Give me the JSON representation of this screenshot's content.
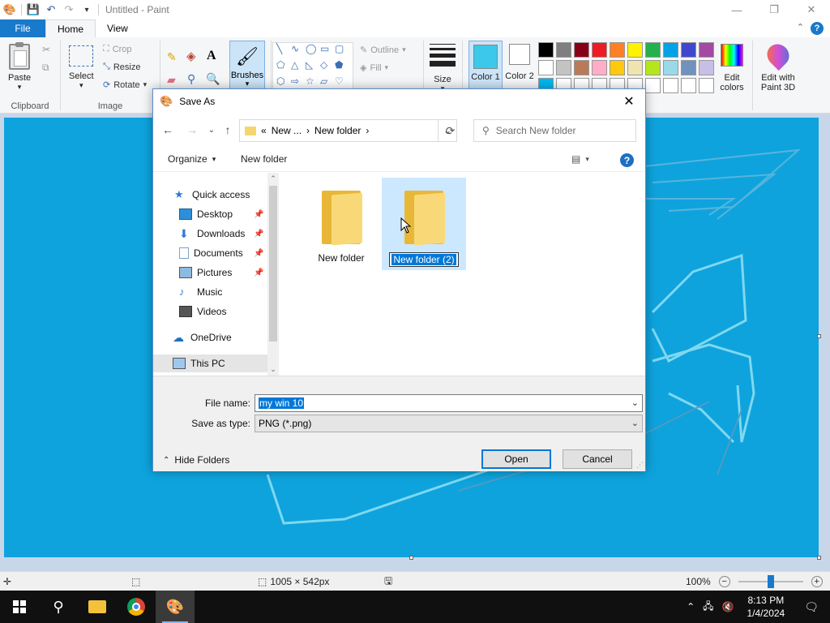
{
  "titlebar": {
    "title": "Untitled - Paint"
  },
  "ribbon_tabs": {
    "file": "File",
    "home": "Home",
    "view": "View"
  },
  "ribbon": {
    "clipboard": {
      "paste": "Paste",
      "group": "Clipboard"
    },
    "image": {
      "select": "Select",
      "crop": "Crop",
      "resize": "Resize",
      "rotate": "Rotate",
      "group": "Image"
    },
    "brushes": "Brushes",
    "shapes": {
      "outline": "Outline",
      "fill": "Fill"
    },
    "size": "Size",
    "color1": "Color 1",
    "color2": "Color 2",
    "edit_colors": "Edit colors",
    "edit_paint3d": "Edit with Paint 3D",
    "palette": [
      "#000000",
      "#7f7f7f",
      "#880015",
      "#ed1c24",
      "#ff7f27",
      "#fff200",
      "#22b14c",
      "#00a2e8",
      "#3f48cc",
      "#a349a4",
      "#ffffff",
      "#c3c3c3",
      "#b97a57",
      "#ffaec9",
      "#ffc90e",
      "#efe4b0",
      "#b5e61d",
      "#99d9ea",
      "#7092be",
      "#c8bfe7",
      "#00b7ef",
      "#ffffff",
      "#ffffff",
      "#ffffff",
      "#ffffff",
      "#ffffff",
      "#ffffff",
      "#ffffff",
      "#ffffff",
      "#ffffff"
    ],
    "color1_value": "#3cc8ea",
    "color2_value": "#ffffff"
  },
  "dialog": {
    "title": "Save As",
    "address": {
      "prefix": "«",
      "crumb1": "New ...",
      "crumb2": "New folder"
    },
    "search_placeholder": "Search New folder",
    "organize": "Organize",
    "new_folder": "New folder",
    "nav": [
      {
        "label": "Quick access"
      },
      {
        "label": "Desktop"
      },
      {
        "label": "Downloads"
      },
      {
        "label": "Documents"
      },
      {
        "label": "Pictures"
      },
      {
        "label": "Music"
      },
      {
        "label": "Videos"
      },
      {
        "label": "OneDrive"
      },
      {
        "label": "This PC"
      }
    ],
    "files": [
      {
        "name": "New folder"
      },
      {
        "name": "New folder (2)"
      }
    ],
    "file_name_label": "File name:",
    "file_name_value": "my win 10",
    "save_as_type_label": "Save as type:",
    "save_as_type_value": "PNG (*.png)",
    "hide_folders": "Hide Folders",
    "open": "Open",
    "cancel": "Cancel"
  },
  "statusbar": {
    "dimensions": "1005 × 542px",
    "zoom": "100%"
  },
  "taskbar": {
    "time": "8:13 PM",
    "date": "1/4/2024"
  }
}
